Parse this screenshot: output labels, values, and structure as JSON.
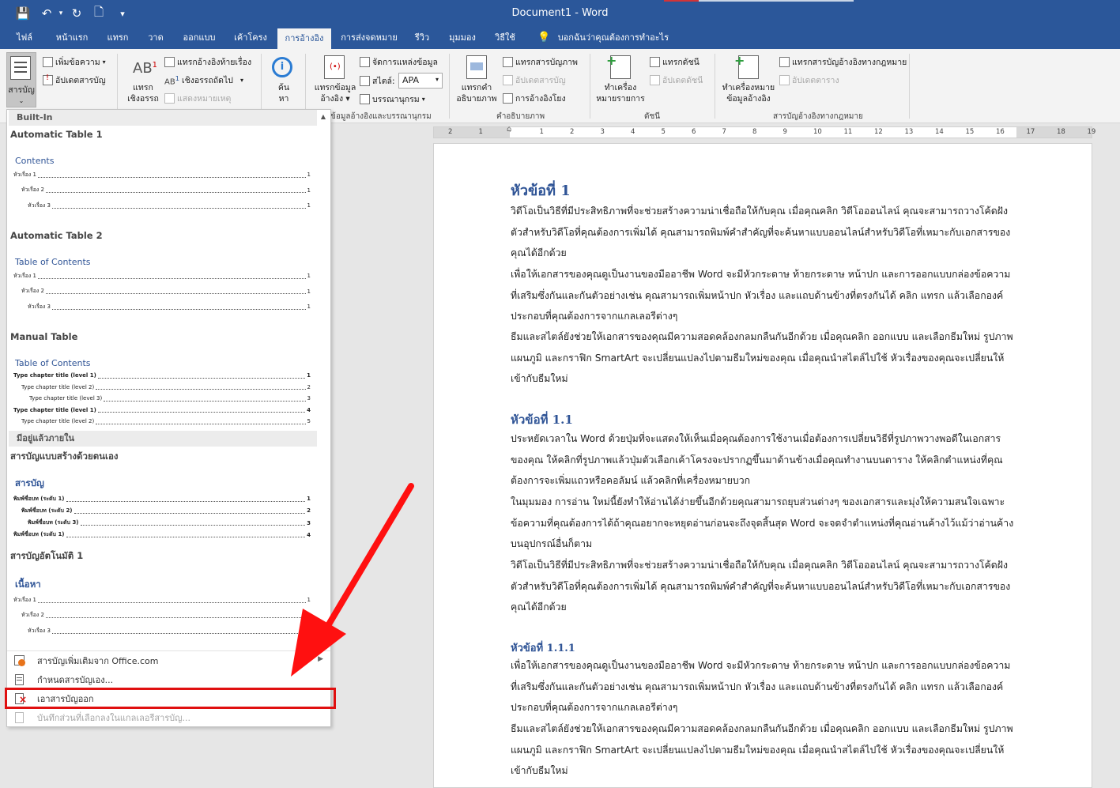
{
  "window": {
    "title": "Document1  -  Word"
  },
  "quick_access": {
    "save": "💾",
    "undo": "↶",
    "redo": "↻",
    "new": "🗋",
    "customize": "▾"
  },
  "tabs": [
    "ไฟล์",
    "หน้าแรก",
    "แทรก",
    "วาด",
    "ออกแบบ",
    "เค้าโครง",
    "การอ้างอิง",
    "การส่งจดหมาย",
    "รีวิว",
    "มุมมอง",
    "วิธีใช้"
  ],
  "tell_me": "บอกฉันว่าคุณต้องการทำอะไร",
  "ribbon": {
    "toc_button": "สารบัญ",
    "add_text": "เพิ่มข้อความ",
    "update_table": "อัปเดตสารบัญ",
    "insert_footnote_1": "แทรก",
    "insert_footnote_2": "เชิงอรรถ",
    "insert_endnote": "แทรกอ้างอิงท้ายเรื่อง",
    "next_footnote": "เชิงอรรถถัดไป",
    "show_notes": "แสดงหมายเหตุ",
    "search_1": "ค้น",
    "search_2": "หา",
    "insert_citation_1": "แทรกข้อมูล",
    "insert_citation_2": "อ้างอิง",
    "manage_sources": "จัดการแหล่งข้อมูล",
    "style_label": "สไตล์:",
    "style_value": "APA",
    "bibliography": "บรรณานุกรม",
    "insert_caption_1": "แทรกคำ",
    "insert_caption_2": "อธิบายภาพ",
    "insert_tof": "แทรกสารบัญภาพ",
    "update_tof": "อัปเดตสารบัญ",
    "cross_ref": "การอ้างอิงโยง",
    "mark_entry_1": "ทำเครื่อง",
    "mark_entry_2": "หมายรายการ",
    "insert_index": "แทรกดัชนี",
    "update_index": "อัปเดตดัชนี",
    "mark_citation_1": "ทำเครื่องหมาย",
    "mark_citation_2": "ข้อมูลอ้างอิง",
    "insert_toa": "แทรกสารบัญอ้างอิงทางกฎหมาย",
    "update_toa": "อัปเดตตาราง",
    "groups": {
      "citations": "ข้อมูลอ้างอิงและบรรณานุกรม",
      "captions": "คำอธิบายภาพ",
      "index": "ดัชนี",
      "toa": "สารบัญอ้างอิงทางกฎหมาย"
    }
  },
  "ruler_ticks": [
    "2",
    "1",
    "",
    "1",
    "2",
    "3",
    "4",
    "5",
    "6",
    "7",
    "8",
    "9",
    "10",
    "11",
    "12",
    "13",
    "14",
    "15",
    "16",
    "17",
    "18",
    "19"
  ],
  "gallery": {
    "builtin": "Built-In",
    "auto1_title": "Automatic Table 1",
    "auto1_heading": "Contents",
    "auto2_title": "Automatic Table 2",
    "auto2_heading": "Table of Contents",
    "manual_title": "Manual Table",
    "manual_heading": "Table of Contents",
    "available_head": "มีอยู่แล้วภายใน",
    "custom_title": "สารบัญแบบสร้างด้วยตนเอง",
    "custom_heading": "สารบัญ",
    "auto_th_title": "สารบัญอัตโนมัติ 1",
    "auto_th_heading": "เนื้อหา",
    "toc_auto1": [
      {
        "text": "หัวเรื่อง 1",
        "page": "1"
      },
      {
        "text": "หัวเรื่อง 2",
        "page": "1"
      },
      {
        "text": "หัวเรื่อง 3",
        "page": "1"
      }
    ],
    "toc_auto2": [
      {
        "text": "หัวเรื่อง 1",
        "page": "1"
      },
      {
        "text": "หัวเรื่อง 2",
        "page": "1"
      },
      {
        "text": "หัวเรื่อง 3",
        "page": "1"
      }
    ],
    "toc_manual": [
      {
        "text": "Type chapter title (level 1)",
        "page": "1"
      },
      {
        "text": "Type chapter title (level 2)",
        "page": "2"
      },
      {
        "text": "Type chapter title (level 3)",
        "page": "3"
      },
      {
        "text": "Type chapter title (level 1)",
        "page": "4"
      },
      {
        "text": "Type chapter title (level 2)",
        "page": "5"
      }
    ],
    "toc_custom": [
      {
        "text": "พิมพ์ชื่อบท (ระดับ 1)",
        "page": "1"
      },
      {
        "text": "พิมพ์ชื่อบท (ระดับ 2)",
        "page": "2"
      },
      {
        "text": "พิมพ์ชื่อบท (ระดับ 3)",
        "page": "3"
      },
      {
        "text": "พิมพ์ชื่อบท (ระดับ 1)",
        "page": "4"
      }
    ],
    "toc_auto_th": [
      {
        "text": "หัวเรื่อง 1",
        "page": "1"
      },
      {
        "text": "หัวเรื่อง 2",
        "page": "1"
      },
      {
        "text": "หัวเรื่อง 3",
        "page": "1"
      }
    ],
    "menu_more": "สารบัญเพิ่มเติมจาก Office.com",
    "menu_custom": "กำหนดสารบัญเอง...",
    "menu_remove": "เอาสารบัญออก",
    "menu_save": "บันทึกส่วนที่เลือกลงในแกลเลอรีสารบัญ..."
  },
  "document": {
    "h1": "หัวข้อที่ 1",
    "p1": "วิดีโอเป็นวิธีที่มีประสิทธิภาพที่จะช่วยสร้างความน่าเชื่อถือให้กับคุณ เมื่อคุณคลิก วิดีโอออนไลน์ คุณจะสามารถวางโค้ดฝังตัวสำหรับวิดีโอที่คุณต้องการเพิ่มได้ คุณสามารถพิมพ์คำสำคัญที่จะค้นหาแบบออนไลน์สำหรับวิดีโอที่เหมาะกับเอกสารของคุณได้อีกด้วย",
    "p2": "เพื่อให้เอกสารของคุณดูเป็นงานของมืออาชีพ Word จะมีหัวกระดาษ ท้ายกระดาษ หน้าปก และการออกแบบกล่องข้อความที่เสริมซึ่งกันและกันตัวอย่างเช่น คุณสามารถเพิ่มหน้าปก หัวเรื่อง และแถบด้านข้างที่ตรงกันได้ คลิก แทรก แล้วเลือกองค์ประกอบที่คุณต้องการจากแกลเลอรีต่างๆ",
    "p3": "ธีมและสไตล์ยังช่วยให้เอกสารของคุณมีความสอดคล้องกลมกลืนกันอีกด้วย เมื่อคุณคลิก ออกแบบ และเลือกธีมใหม่ รูปภาพ แผนภูมิ และกราฟิก SmartArt จะเปลี่ยนแปลงไปตามธีมใหม่ของคุณ เมื่อคุณนำสไตล์ไปใช้ หัวเรื่องของคุณจะเปลี่ยนให้เข้ากับธีมใหม่",
    "h2": "หัวข้อที่ 1.1",
    "p4": "ประหยัดเวลาใน Word ด้วยปุ่มที่จะแสดงให้เห็นเมื่อคุณต้องการใช้งานเมื่อต้องการเปลี่ยนวิธีที่รูปภาพวางพอดีในเอกสารของคุณ ให้คลิกที่รูปภาพแล้วปุ่มตัวเลือกเค้าโครงจะปรากฏขึ้นมาด้านข้างเมื่อคุณทำงานบนตาราง ให้คลิกตำแหน่งที่คุณต้องการจะเพิ่มแถวหรือคอลัมน์ แล้วคลิกที่เครื่องหมายบวก",
    "p5": "ในมุมมอง การอ่าน ใหม่นี้ยังทำให้อ่านได้ง่ายขึ้นอีกด้วยคุณสามารถยุบส่วนต่างๆ ของเอกสารและมุ่งให้ความสนใจเฉพาะข้อความที่คุณต้องการได้ถ้าคุณอยากจะหยุดอ่านก่อนจะถึงจุดสิ้นสุด Word จะจดจำตำแหน่งที่คุณอ่านค้างไว้แม้ว่าอ่านค้างบนอุปกรณ์อื่นก็ตาม",
    "p6": "วิดีโอเป็นวิธีที่มีประสิทธิภาพที่จะช่วยสร้างความน่าเชื่อถือให้กับคุณ เมื่อคุณคลิก วิดีโอออนไลน์ คุณจะสามารถวางโค้ดฝังตัวสำหรับวิดีโอที่คุณต้องการเพิ่มได้ คุณสามารถพิมพ์คำสำคัญที่จะค้นหาแบบออนไลน์สำหรับวิดีโอที่เหมาะกับเอกสารของคุณได้อีกด้วย",
    "h3": "หัวข้อที่ 1.1.1",
    "p7": "เพื่อให้เอกสารของคุณดูเป็นงานของมืออาชีพ Word จะมีหัวกระดาษ ท้ายกระดาษ หน้าปก และการออกแบบกล่องข้อความที่เสริมซึ่งกันและกันตัวอย่างเช่น คุณสามารถเพิ่มหน้าปก หัวเรื่อง และแถบด้านข้างที่ตรงกันได้ คลิก แทรก แล้วเลือกองค์ประกอบที่คุณต้องการจากแกลเลอรีต่างๆ",
    "p8": "ธีมและสไตล์ยังช่วยให้เอกสารของคุณมีความสอดคล้องกลมกลืนกันอีกด้วย เมื่อคุณคลิก ออกแบบ และเลือกธีมใหม่ รูปภาพ แผนภูมิ และกราฟิก SmartArt จะเปลี่ยนแปลงไปตามธีมใหม่ของคุณ เมื่อคุณนำสไตล์ไปใช้ หัวเรื่องของคุณจะเปลี่ยนให้เข้ากับธีมใหม่"
  },
  "colors": {
    "word_blue": "#2b579a",
    "heading_blue": "#2f5496",
    "annotation_red": "#e01010"
  }
}
